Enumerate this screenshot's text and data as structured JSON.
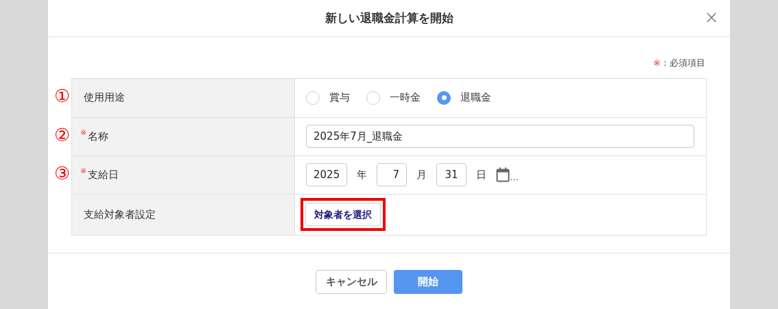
{
  "dialog": {
    "title": "新しい退職金計算を開始",
    "close": "×"
  },
  "required_note": {
    "mark": "※",
    "text": "：必須項目"
  },
  "rows": [
    {
      "kind": "radio",
      "marker": "①",
      "required": false,
      "label": "使用用途",
      "options": [
        {
          "label": "賞与",
          "selected": false
        },
        {
          "label": "一時金",
          "selected": false
        },
        {
          "label": "退職金",
          "selected": true
        }
      ]
    },
    {
      "kind": "text",
      "marker": "②",
      "required": true,
      "required_mark": "※",
      "label": "名称",
      "value": "2025年7月_退職金"
    },
    {
      "kind": "date",
      "marker": "③",
      "required": true,
      "required_mark": "※",
      "label": "支給日",
      "year": "2025",
      "year_unit": "年",
      "month": "7",
      "month_unit": "月",
      "day": "31",
      "day_unit": "日",
      "more": "…"
    },
    {
      "kind": "button",
      "required": false,
      "label": "支給対象者設定",
      "button": "対象者を選択",
      "highlighted": true
    }
  ],
  "buttons": [
    {
      "label": "キャンセル",
      "kind": "secondary"
    },
    {
      "label": "開始",
      "kind": "primary"
    }
  ]
}
